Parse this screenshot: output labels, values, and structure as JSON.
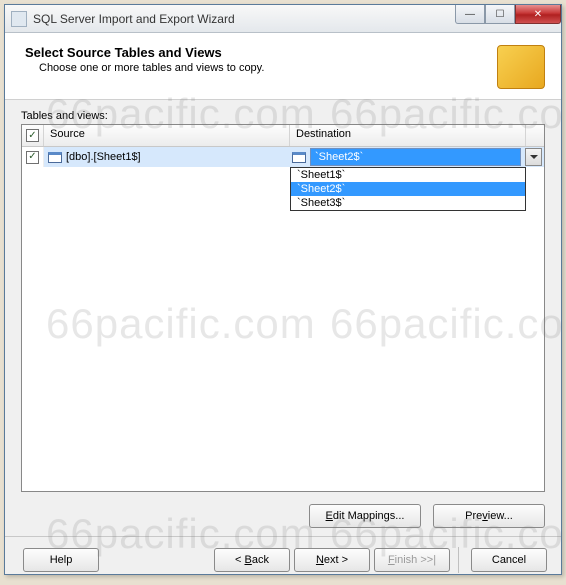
{
  "window": {
    "title": "SQL Server Import and Export Wizard"
  },
  "header": {
    "title": "Select Source Tables and Views",
    "subtitle": "Choose one or more tables and views to copy."
  },
  "tables_label": "Tables and views:",
  "columns": {
    "source": "Source",
    "destination": "Destination"
  },
  "rows": [
    {
      "checked": true,
      "source": "[dbo].[Sheet1$]",
      "destination": "`Sheet2$`"
    }
  ],
  "dropdown": {
    "options": [
      "`Sheet1$`",
      "`Sheet2$`",
      "`Sheet3$`"
    ],
    "selected_index": 1
  },
  "buttons": {
    "edit_mappings": "Edit Mappings...",
    "preview": "Preview...",
    "help": "Help",
    "back": "< Back",
    "next": "Next >",
    "finish": "Finish >>|",
    "cancel": "Cancel"
  },
  "watermark": "66pacific.com"
}
